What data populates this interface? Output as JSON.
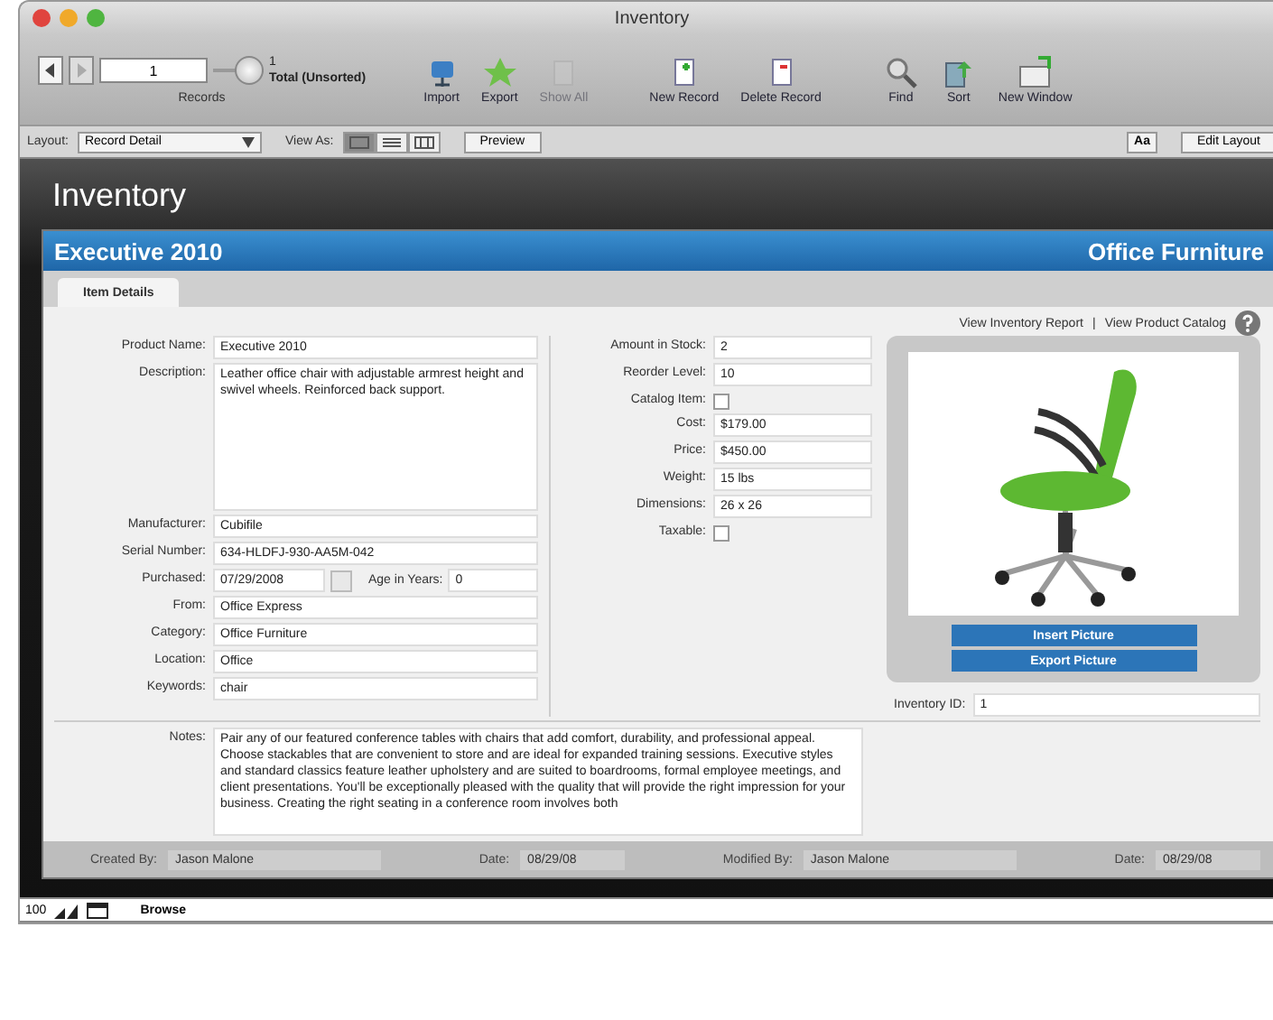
{
  "window": {
    "title": "Inventory"
  },
  "toolbar": {
    "record_field": "1",
    "record_count": "1",
    "record_status": "Total (Unsorted)",
    "records_label": "Records",
    "record_slider": {
      "level": 1
    },
    "buttons": [
      {
        "label": "Import",
        "disabled": false
      },
      {
        "label": "Export",
        "disabled": false
      },
      {
        "label": "Show All",
        "disabled": true
      },
      {
        "label": "New Record",
        "disabled": false
      },
      {
        "label": "Delete Record",
        "disabled": false
      },
      {
        "label": "Find",
        "disabled": false
      },
      {
        "label": "Sort",
        "disabled": false
      },
      {
        "label": "New Window",
        "disabled": false
      }
    ]
  },
  "layout_bar": {
    "layout_label": "Layout:",
    "layout_value": "Record Detail",
    "view_label": "View As:",
    "views": [
      {
        "selected": true
      },
      {
        "selected": false
      },
      {
        "selected": false
      }
    ],
    "preview": "Preview",
    "aa": "Aa",
    "edit_layout": "Edit Layout"
  },
  "page_title": "Inventory",
  "record": {
    "name": "Executive 2010",
    "category": "Office Furniture",
    "tabs": [
      {
        "label": "Item Details",
        "selected": true
      }
    ],
    "links": [
      "View Inventory Report",
      "View Product Catalog"
    ],
    "link_separator": "|",
    "left_fields": [
      {
        "label": "Product Name:",
        "value": "Executive 2010",
        "kind": "text"
      },
      {
        "label": "Description:",
        "value": "Leather office chair with adjustable armrest height and swivel wheels. Reinforced back support.",
        "kind": "textarea"
      },
      {
        "label": "Manufacturer:",
        "value": "Cubifile",
        "kind": "text"
      },
      {
        "label": "Serial Number:",
        "value": "634-HLDFJ-930-AA5M-042",
        "kind": "text"
      },
      {
        "label": "Purchased:",
        "value": "07/29/2008",
        "kind": "date",
        "extra_label": "Age in Years:",
        "extra_value": "0"
      },
      {
        "label": "From:",
        "value": "Office Express",
        "kind": "text"
      },
      {
        "label": "Category:",
        "value": "Office Furniture",
        "kind": "text"
      },
      {
        "label": "Location:",
        "value": "Office",
        "kind": "text"
      },
      {
        "label": "Keywords:",
        "value": "chair",
        "kind": "text"
      }
    ],
    "right_fields": [
      {
        "label": "Amount in Stock:",
        "value": "2",
        "kind": "text"
      },
      {
        "label": "Reorder Level:",
        "value": "10",
        "kind": "text"
      },
      {
        "label": "Catalog Item:",
        "kind": "checkbox",
        "checked": false
      },
      {
        "label": "Cost:",
        "value": "$179.00",
        "kind": "text"
      },
      {
        "label": "Price:",
        "value": "$450.00",
        "kind": "text"
      },
      {
        "label": "Weight:",
        "value": "15 lbs",
        "kind": "text"
      },
      {
        "label": "Dimensions:",
        "value": "26 x 26",
        "kind": "text"
      },
      {
        "label": "Taxable:",
        "kind": "checkbox",
        "checked": false
      }
    ],
    "picture_buttons": [
      "Insert Picture",
      "Export Picture"
    ],
    "inventory_id": {
      "label": "Inventory ID:",
      "value": "1"
    },
    "notes": {
      "label": "Notes:",
      "value": "Pair any of our featured conference tables with chairs that add comfort, durability, and professional appeal. Choose stackables that are convenient to store and are ideal for expanded training sessions. Executive styles and standard classics feature leather upholstery and are suited to boardrooms, formal employee meetings, and client presentations. You'll be exceptionally pleased with the quality that will provide the right impression for your business. Creating the right seating in a conference room involves both"
    },
    "footer": [
      {
        "label": "Created By:",
        "value": "Jason Malone"
      },
      {
        "label": "Date:",
        "value": "08/29/08"
      },
      {
        "label": "Modified By:",
        "value": "Jason Malone"
      },
      {
        "label": "Date:",
        "value": "08/29/08"
      }
    ]
  },
  "status_bar": {
    "zoom": "100",
    "mode": "Browse"
  }
}
